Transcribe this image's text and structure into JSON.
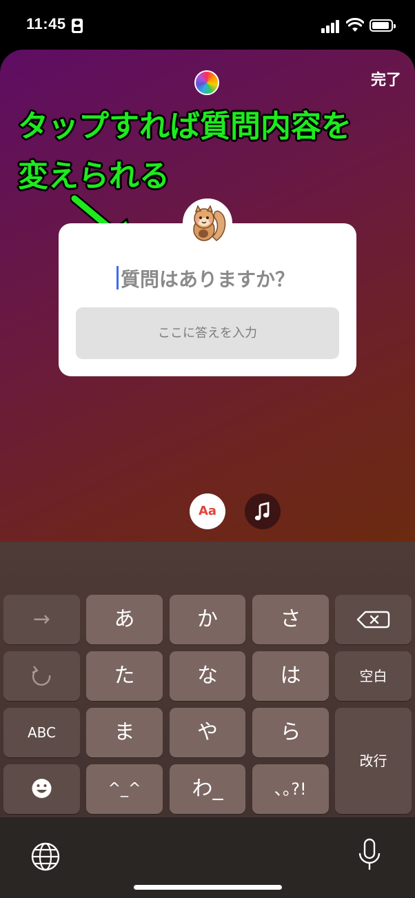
{
  "status_bar": {
    "time": "11:45"
  },
  "story": {
    "done_label": "完了",
    "annotation_line1": "タップすれば質問内容を",
    "annotation_line2": "変えられる",
    "question_placeholder": "質問はありますか？",
    "answer_placeholder": "ここに答えを入力",
    "text_tool_label": "Aa"
  },
  "keyboard": {
    "row1": [
      "→",
      "あ",
      "か",
      "さ"
    ],
    "row2": [
      "た",
      "な",
      "は"
    ],
    "space_label": "空白",
    "row3": [
      "ABC",
      "ま",
      "や",
      "ら"
    ],
    "return_label": "改行",
    "row4": [
      "^_^",
      "わ_",
      "､｡?!"
    ]
  },
  "icons": {
    "arrow": "arrow-right-icon",
    "backspace": "backspace-icon",
    "undo": "undo-icon",
    "emoji": "emoji-icon",
    "globe": "globe-icon",
    "mic": "microphone-icon",
    "music": "music-note-icon"
  },
  "colors": {
    "annotation": "#1eea1e",
    "caret": "#3b6cf0"
  }
}
